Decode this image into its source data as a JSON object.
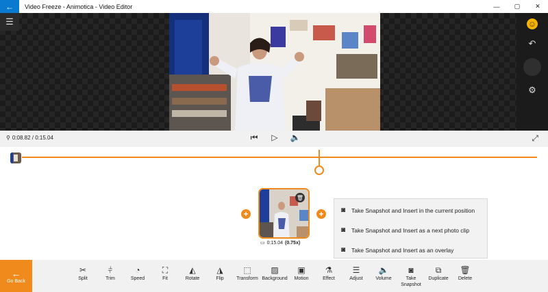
{
  "window": {
    "title": "Video Freeze - Animotica - Video Editor",
    "back_glyph": "←",
    "minimize": "—",
    "maximize": "▢",
    "close": "✕"
  },
  "preview": {
    "menu_icon": "hamburger-icon",
    "right_icons": [
      "emoji-icon",
      "undo-icon",
      "blank-circle",
      "gear-icon"
    ]
  },
  "transport": {
    "time": "0:08.82 / 0:15.04"
  },
  "clip": {
    "duration": "0:15.04",
    "speed": "(0.75x)"
  },
  "snapshot_menu": {
    "items": [
      "Take Snapshot and Insert in the current position",
      "Take Snapshot and Insert as a next photo clip",
      "Take Snapshot and Insert as an overlay"
    ]
  },
  "toolbar": {
    "go_back": "Go Back",
    "tools": [
      {
        "label": "Split",
        "icon": "scissors-icon"
      },
      {
        "label": "Trim",
        "icon": "trim-icon"
      },
      {
        "label": "Speed",
        "icon": "speedometer-icon"
      },
      {
        "label": "Fit",
        "icon": "fit-icon"
      },
      {
        "label": "Rotate",
        "icon": "rotate-icon"
      },
      {
        "label": "Flip",
        "icon": "flip-icon"
      },
      {
        "label": "Transform",
        "icon": "transform-icon"
      },
      {
        "label": "Background",
        "icon": "background-icon"
      },
      {
        "label": "Motion",
        "icon": "motion-icon"
      },
      {
        "label": "Effect",
        "icon": "effect-icon"
      },
      {
        "label": "Adjust",
        "icon": "adjust-icon"
      },
      {
        "label": "Volume",
        "icon": "volume-icon"
      },
      {
        "label": "Take Snapshot",
        "icon": "camera-icon"
      },
      {
        "label": "Duplicate",
        "icon": "duplicate-icon"
      },
      {
        "label": "Delete",
        "icon": "trash-icon"
      }
    ]
  },
  "colors": {
    "accent": "#f08a1c",
    "titlebar_back": "#0a7ad0"
  }
}
